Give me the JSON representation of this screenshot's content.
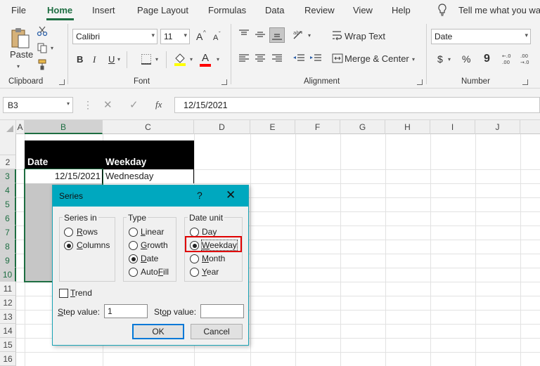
{
  "ribbon_tabs": [
    "File",
    "Home",
    "Insert",
    "Page Layout",
    "Formulas",
    "Data",
    "Review",
    "View",
    "Help"
  ],
  "tell_me": "Tell me what you wa",
  "clipboard": {
    "paste_label": "Paste",
    "group_label": "Clipboard"
  },
  "font": {
    "name": "Calibri",
    "size": "11",
    "group_label": "Font",
    "bold": "B",
    "italic": "I",
    "underline": "U",
    "grow": "A",
    "shrink": "A",
    "font_color_letter": "A",
    "fill_color": "#ffff00",
    "font_color": "#ff0000"
  },
  "alignment": {
    "wrap_text": "Wrap Text",
    "merge_center": "Merge & Center",
    "group_label": "Alignment"
  },
  "number": {
    "format": "Date",
    "currency": "$",
    "percent": "%",
    "comma": "9",
    "group_label": "Number"
  },
  "formula_bar": {
    "name_box": "B3",
    "fx": "fx",
    "value": "12/15/2021"
  },
  "columns": [
    "A",
    "B",
    "C",
    "D",
    "E",
    "F",
    "G",
    "H",
    "I",
    "J"
  ],
  "rows": [
    "2",
    "3",
    "4",
    "5",
    "6",
    "7",
    "8",
    "9",
    "10",
    "11",
    "12",
    "13",
    "14",
    "15",
    "16"
  ],
  "sheet": {
    "header_date": "Date",
    "header_weekday": "Weekday",
    "b3": "12/15/2021",
    "c3": "Wednesday"
  },
  "dialog": {
    "title": "Series",
    "help": "?",
    "series_in": {
      "legend": "Series in",
      "rows": "ows",
      "rows_key": "R",
      "columns": "olumns",
      "columns_key": "C"
    },
    "type": {
      "legend": "Type",
      "linear": "inear",
      "linear_key": "L",
      "growth": "rowth",
      "growth_key": "G",
      "date": "ate",
      "date_key": "D",
      "autofill": "Auto",
      "autofill_key": "F",
      "autofill_rest": "ill"
    },
    "date_unit": {
      "legend": "Date unit",
      "day": "Day",
      "weekday": "eekday",
      "weekday_key": "W",
      "month": "onth",
      "month_key": "M",
      "year": "ear",
      "year_key": "Y"
    },
    "trend": "rend",
    "trend_key": "T",
    "step_label": "tep value:",
    "step_key": "S",
    "step_value": "1",
    "stop_label_pre": "St",
    "stop_key": "o",
    "stop_label_post": "p value:",
    "stop_value": "",
    "ok": "OK",
    "cancel": "Cancel"
  },
  "colors": {
    "accent": "#1e6e42",
    "dialog_title": "#00a8bf",
    "highlight": "#e00000"
  }
}
